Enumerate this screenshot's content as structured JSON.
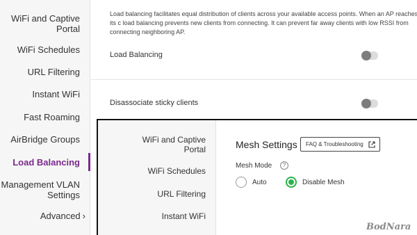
{
  "sidebar": {
    "items": [
      {
        "label": "WiFi and Captive"
      },
      {
        "label": "Portal"
      },
      {
        "label": "WiFi Schedules"
      },
      {
        "label": "URL Filtering"
      },
      {
        "label": "Instant WiFi"
      },
      {
        "label": "Fast Roaming"
      },
      {
        "label": "AirBridge Groups"
      },
      {
        "label": "Load Balancing",
        "active": true
      },
      {
        "label": "Management VLAN"
      },
      {
        "label": "Settings"
      },
      {
        "label": "Advanced"
      }
    ],
    "advanced_chevron": "›",
    "active_color": "#7a2a8c"
  },
  "main": {
    "description": "Load balancing facilitates equal distribution of clients across your available access points. When an AP reaches its c load balancing prevents new clients from connecting. It can prevent far away clients with low RSSI from connecting neighboring AP.",
    "settings": [
      {
        "label": "Load Balancing",
        "enabled": false
      },
      {
        "label": "Disassociate sticky clients",
        "enabled": false
      }
    ]
  },
  "overlay": {
    "sidebar_items": [
      {
        "label": "WiFi and Captive"
      },
      {
        "label": "Portal"
      },
      {
        "label": "WiFi Schedules"
      },
      {
        "label": "URL Filtering"
      },
      {
        "label": "Instant WiFi"
      }
    ],
    "title": "Mesh Settings",
    "faq_button": "FAQ & Troubleshooting",
    "faq_icon": "external-link-icon",
    "mesh_mode_label": "Mesh Mode",
    "help_icon_text": "?",
    "options": [
      {
        "label": "Auto",
        "checked": false
      },
      {
        "label": "Disable Mesh",
        "checked": true
      }
    ],
    "accent_color": "#2bb34a"
  },
  "watermark": "BodNara"
}
